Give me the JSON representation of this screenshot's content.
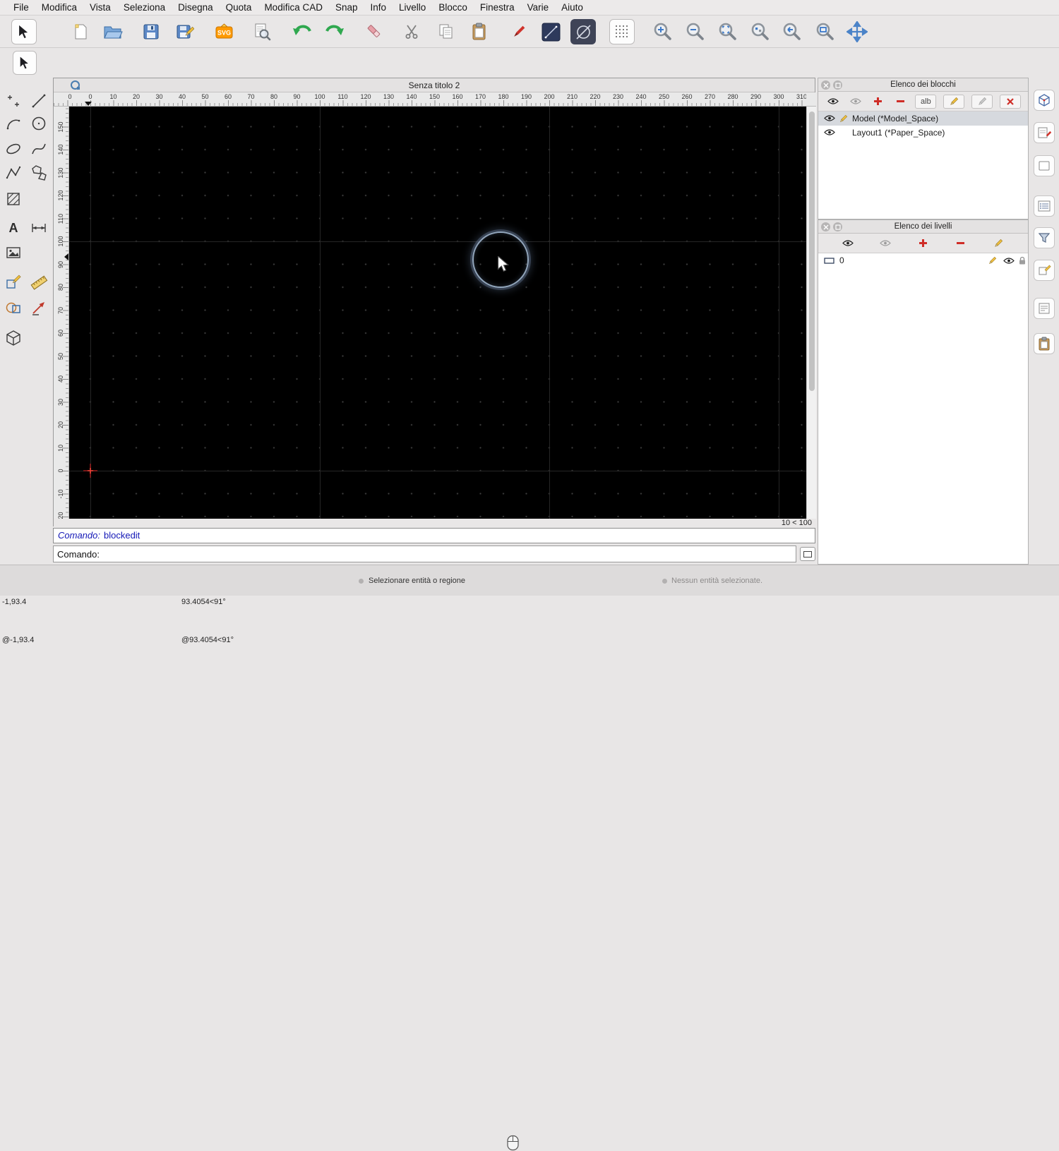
{
  "menu": {
    "items": [
      "File",
      "Modifica",
      "Vista",
      "Seleziona",
      "Disegna",
      "Quota",
      "Modifica CAD",
      "Snap",
      "Info",
      "Livello",
      "Blocco",
      "Finestra",
      "Varie",
      "Aiuto"
    ]
  },
  "window": {
    "title": "Senza titolo 2",
    "grid_info": "10 < 100"
  },
  "rulers": {
    "horizontal": [
      "0",
      "0",
      "10",
      "20",
      "30",
      "40",
      "50",
      "60",
      "70",
      "80",
      "90",
      "100",
      "110",
      "120",
      "130",
      "140",
      "150",
      "160",
      "170",
      "180",
      "190",
      "200",
      "210",
      "220",
      "230",
      "240",
      "250",
      "260",
      "270",
      "280",
      "290",
      "300",
      "310"
    ],
    "vertical": [
      "150",
      "140",
      "130",
      "120",
      "110",
      "100",
      "90",
      "80",
      "70",
      "60",
      "50",
      "40",
      "30",
      "20",
      "10",
      "0",
      "-10",
      "-20"
    ]
  },
  "command": {
    "history_prompt": "Comando:",
    "history_value": "blockedit",
    "prompt": "Comando:",
    "input_value": ""
  },
  "panels": {
    "blocks": {
      "title": "Elenco dei blocchi",
      "rename_label": "alb",
      "items": [
        {
          "name": "Model (*Model_Space)",
          "selected": true
        },
        {
          "name": "Layout1 (*Paper_Space)",
          "selected": false
        }
      ]
    },
    "layers": {
      "title": "Elenco dei livelli",
      "items": [
        {
          "name": "0"
        }
      ]
    }
  },
  "statusbar": {
    "abs_coord": "-1,93.4",
    "rel_coord": "@-1,93.4",
    "polar_coord": "93.4054<91°",
    "polar_rel_coord": "@93.4054<91°",
    "hint": "Selezionare entità o regione",
    "selection_status": "Nessun entità selezionate."
  },
  "icons": {
    "svg_label": "SVG",
    "text_tool_label": "A"
  },
  "colors": {
    "accent_red": "#cf2d27",
    "canvas": "#000000",
    "selection_highlight": "#d6d9de",
    "command_blue": "#1216b6"
  }
}
